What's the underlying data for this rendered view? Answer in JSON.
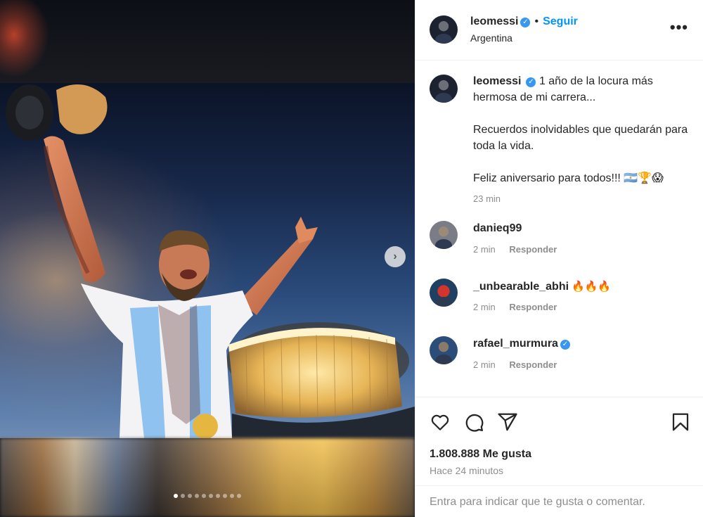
{
  "post": {
    "username": "leomessi",
    "follow_separator": "•",
    "follow_label": "Seguir",
    "location": "Argentina",
    "more_label": "•••",
    "next_label": "›"
  },
  "caption": {
    "username": "leomessi",
    "line1": "1 año de la locura más hermosa de mi carrera...",
    "line2": "Recuerdos inolvidables que quedarán para toda la vida.",
    "line3": "Feliz aniversario para todos!!! 🇦🇷🏆😱",
    "time": "23 min"
  },
  "comments": [
    {
      "username": "danieq99",
      "emojis": "",
      "verified": false,
      "time": "2 min",
      "reply_label": "Responder",
      "avatar_color": "#7a7d85"
    },
    {
      "username": "_unbearable_abhi",
      "emojis": "🔥🔥🔥",
      "verified": false,
      "time": "2 min",
      "reply_label": "Responder",
      "avatar_color": "#1f3f63"
    },
    {
      "username": "rafael_murmura",
      "emojis": "",
      "verified": true,
      "time": "2 min",
      "reply_label": "Responder",
      "avatar_color": "#2a4d7a"
    }
  ],
  "actions": {
    "like_icon": "heart-icon",
    "comment_icon": "comment-icon",
    "share_icon": "share-icon",
    "save_icon": "bookmark-icon",
    "likes_text": "1.808.888 Me gusta",
    "posted_text": "Hace 24 minutos"
  },
  "comment_box": {
    "placeholder": "Entra para indicar que te gusta o comentar."
  },
  "carousel": {
    "dot_count": 10,
    "active_index": 0
  },
  "colors": {
    "link_blue": "#0095f6",
    "verified_blue": "#3897f0",
    "muted_text": "#8e8e8e"
  }
}
